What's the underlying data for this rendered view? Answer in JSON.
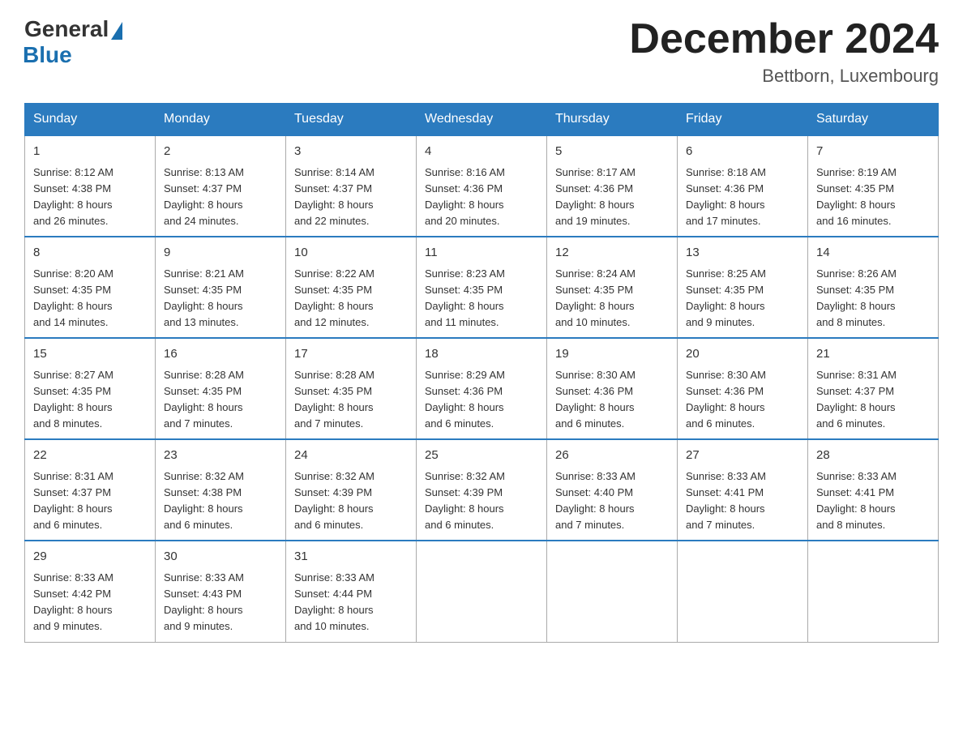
{
  "header": {
    "logo_general": "General",
    "logo_blue": "Blue",
    "month_title": "December 2024",
    "location": "Bettborn, Luxembourg"
  },
  "days_of_week": [
    "Sunday",
    "Monday",
    "Tuesday",
    "Wednesday",
    "Thursday",
    "Friday",
    "Saturday"
  ],
  "weeks": [
    [
      {
        "day": "1",
        "sunrise": "8:12 AM",
        "sunset": "4:38 PM",
        "daylight": "8 hours and 26 minutes."
      },
      {
        "day": "2",
        "sunrise": "8:13 AM",
        "sunset": "4:37 PM",
        "daylight": "8 hours and 24 minutes."
      },
      {
        "day": "3",
        "sunrise": "8:14 AM",
        "sunset": "4:37 PM",
        "daylight": "8 hours and 22 minutes."
      },
      {
        "day": "4",
        "sunrise": "8:16 AM",
        "sunset": "4:36 PM",
        "daylight": "8 hours and 20 minutes."
      },
      {
        "day": "5",
        "sunrise": "8:17 AM",
        "sunset": "4:36 PM",
        "daylight": "8 hours and 19 minutes."
      },
      {
        "day": "6",
        "sunrise": "8:18 AM",
        "sunset": "4:36 PM",
        "daylight": "8 hours and 17 minutes."
      },
      {
        "day": "7",
        "sunrise": "8:19 AM",
        "sunset": "4:35 PM",
        "daylight": "8 hours and 16 minutes."
      }
    ],
    [
      {
        "day": "8",
        "sunrise": "8:20 AM",
        "sunset": "4:35 PM",
        "daylight": "8 hours and 14 minutes."
      },
      {
        "day": "9",
        "sunrise": "8:21 AM",
        "sunset": "4:35 PM",
        "daylight": "8 hours and 13 minutes."
      },
      {
        "day": "10",
        "sunrise": "8:22 AM",
        "sunset": "4:35 PM",
        "daylight": "8 hours and 12 minutes."
      },
      {
        "day": "11",
        "sunrise": "8:23 AM",
        "sunset": "4:35 PM",
        "daylight": "8 hours and 11 minutes."
      },
      {
        "day": "12",
        "sunrise": "8:24 AM",
        "sunset": "4:35 PM",
        "daylight": "8 hours and 10 minutes."
      },
      {
        "day": "13",
        "sunrise": "8:25 AM",
        "sunset": "4:35 PM",
        "daylight": "8 hours and 9 minutes."
      },
      {
        "day": "14",
        "sunrise": "8:26 AM",
        "sunset": "4:35 PM",
        "daylight": "8 hours and 8 minutes."
      }
    ],
    [
      {
        "day": "15",
        "sunrise": "8:27 AM",
        "sunset": "4:35 PM",
        "daylight": "8 hours and 8 minutes."
      },
      {
        "day": "16",
        "sunrise": "8:28 AM",
        "sunset": "4:35 PM",
        "daylight": "8 hours and 7 minutes."
      },
      {
        "day": "17",
        "sunrise": "8:28 AM",
        "sunset": "4:35 PM",
        "daylight": "8 hours and 7 minutes."
      },
      {
        "day": "18",
        "sunrise": "8:29 AM",
        "sunset": "4:36 PM",
        "daylight": "8 hours and 6 minutes."
      },
      {
        "day": "19",
        "sunrise": "8:30 AM",
        "sunset": "4:36 PM",
        "daylight": "8 hours and 6 minutes."
      },
      {
        "day": "20",
        "sunrise": "8:30 AM",
        "sunset": "4:36 PM",
        "daylight": "8 hours and 6 minutes."
      },
      {
        "day": "21",
        "sunrise": "8:31 AM",
        "sunset": "4:37 PM",
        "daylight": "8 hours and 6 minutes."
      }
    ],
    [
      {
        "day": "22",
        "sunrise": "8:31 AM",
        "sunset": "4:37 PM",
        "daylight": "8 hours and 6 minutes."
      },
      {
        "day": "23",
        "sunrise": "8:32 AM",
        "sunset": "4:38 PM",
        "daylight": "8 hours and 6 minutes."
      },
      {
        "day": "24",
        "sunrise": "8:32 AM",
        "sunset": "4:39 PM",
        "daylight": "8 hours and 6 minutes."
      },
      {
        "day": "25",
        "sunrise": "8:32 AM",
        "sunset": "4:39 PM",
        "daylight": "8 hours and 6 minutes."
      },
      {
        "day": "26",
        "sunrise": "8:33 AM",
        "sunset": "4:40 PM",
        "daylight": "8 hours and 7 minutes."
      },
      {
        "day": "27",
        "sunrise": "8:33 AM",
        "sunset": "4:41 PM",
        "daylight": "8 hours and 7 minutes."
      },
      {
        "day": "28",
        "sunrise": "8:33 AM",
        "sunset": "4:41 PM",
        "daylight": "8 hours and 8 minutes."
      }
    ],
    [
      {
        "day": "29",
        "sunrise": "8:33 AM",
        "sunset": "4:42 PM",
        "daylight": "8 hours and 9 minutes."
      },
      {
        "day": "30",
        "sunrise": "8:33 AM",
        "sunset": "4:43 PM",
        "daylight": "8 hours and 9 minutes."
      },
      {
        "day": "31",
        "sunrise": "8:33 AM",
        "sunset": "4:44 PM",
        "daylight": "8 hours and 10 minutes."
      },
      null,
      null,
      null,
      null
    ]
  ],
  "labels": {
    "sunrise": "Sunrise:",
    "sunset": "Sunset:",
    "daylight": "Daylight:"
  }
}
